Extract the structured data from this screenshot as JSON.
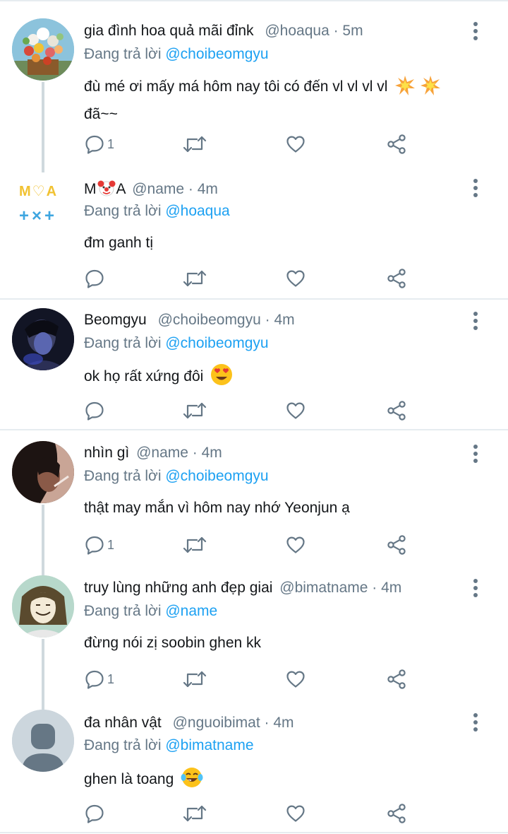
{
  "colors": {
    "accent": "#1da1f2",
    "secondary_text": "#657786",
    "primary_text": "#14171a",
    "divider": "#e6ecf0",
    "thread_line": "#cfd9de"
  },
  "reply_prefix": "Đang trả lời",
  "tweets": [
    {
      "name": "gia đình hoa quả mãi đỉnk",
      "meta": "@hoaqua · 5m",
      "reply_to": "@choibeomgyu",
      "text": "đù mé ơi mấy má hôm nay tôi có đến vl vl vl vl",
      "text_line2": "đã~~",
      "emoji": [
        "collision-emoji",
        "collision-emoji"
      ],
      "reply_count": "1",
      "avatar": "flower-bouquet-avatar"
    },
    {
      "name_prefix": "M",
      "name_suffix": "A",
      "name_emoji": "clown-face-emoji",
      "meta": "@name · 4m",
      "reply_to": "@hoaqua",
      "text": "đm ganh tị",
      "reply_count": "",
      "avatar": "moa-txt-logo-avatar",
      "avatar_text_top": "M♡A",
      "avatar_text_bottom": "+×+"
    },
    {
      "name": "Beomgyu",
      "meta": "@choibeomgyu · 4m",
      "reply_to": "@choibeomgyu",
      "text": "ok họ rất xứng đôi",
      "emoji": [
        "heart-eyes-emoji"
      ],
      "reply_count": "",
      "avatar": "portrait-avatar"
    },
    {
      "name": "nhìn gì",
      "meta": "@name · 4m",
      "reply_to": "@choibeomgyu",
      "text": "thật may mắn vì hôm nay nhớ Yeonjun ạ",
      "reply_count": "1",
      "avatar": "dark-portrait-avatar"
    },
    {
      "name": "truy lùng những anh đẹp giai",
      "meta": "@bimatname · 4m",
      "reply_to": "@name",
      "text": "đừng nói zị soobin ghen kk",
      "reply_count": "1",
      "avatar": "cartoon-avatar"
    },
    {
      "name": "đa nhân vật",
      "meta": "@nguoibimat · 4m",
      "reply_to": "@bimatname",
      "text": "ghen là toang",
      "emoji": [
        "tears-of-joy-emoji"
      ],
      "reply_count": "",
      "avatar": "default-person-avatar"
    }
  ]
}
